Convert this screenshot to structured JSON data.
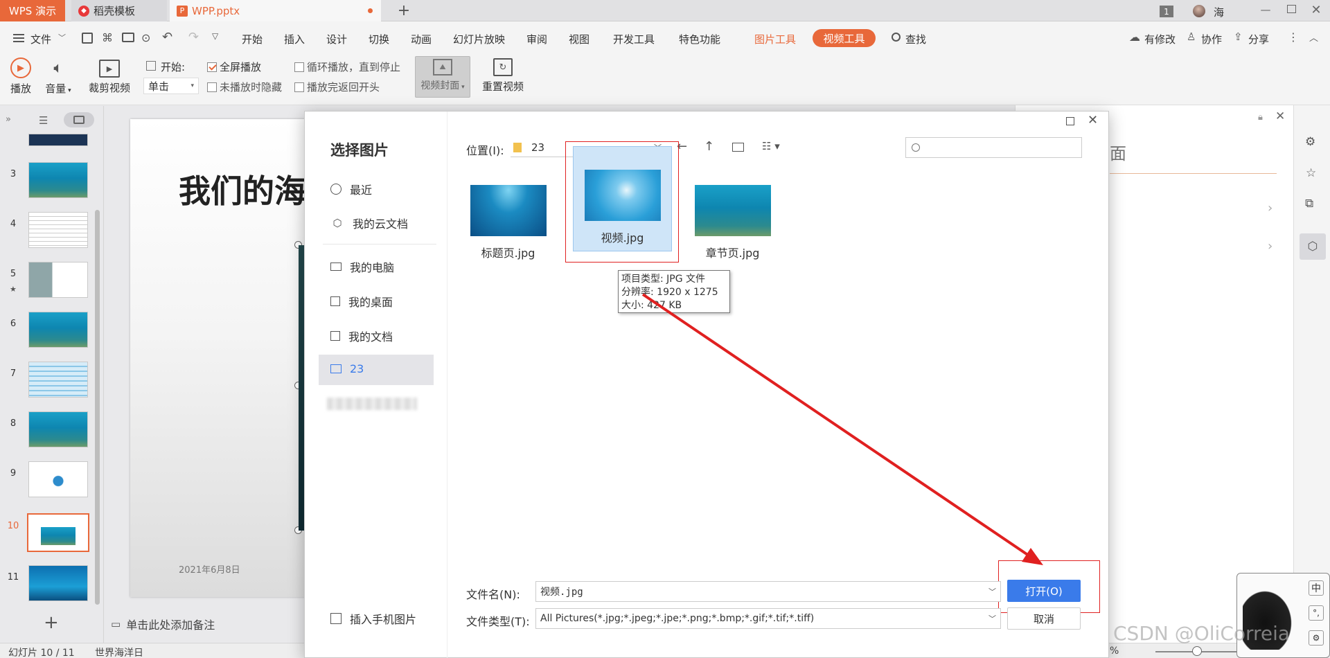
{
  "titlebar": {
    "app_tab": "WPS 演示",
    "template_tab": "稻壳模板",
    "doc_tab": "WPP.pptx",
    "page_badge": "1",
    "user_name": "海"
  },
  "menu": {
    "file": "文件",
    "items": [
      "开始",
      "插入",
      "设计",
      "切换",
      "动画",
      "幻灯片放映",
      "审阅",
      "视图",
      "开发工具",
      "特色功能"
    ],
    "picture_tools": "图片工具",
    "video_tools": "视频工具",
    "search": "查找",
    "modified": "有修改",
    "collab": "协作",
    "share": "分享"
  },
  "toolbar": {
    "play": "播放",
    "volume": "音量",
    "trim": "裁剪视频",
    "start_label": "开始:",
    "start_value": "单击",
    "fullscreen": "全屏播放",
    "hide_when_not_playing": "未播放时隐藏",
    "loop": "循环播放，直到停止",
    "rewind": "播放完返回开头",
    "cover": "视频封面",
    "reset": "重置视频"
  },
  "slides": [
    {
      "num": "3"
    },
    {
      "num": "4"
    },
    {
      "num": "5"
    },
    {
      "num": "6"
    },
    {
      "num": "7"
    },
    {
      "num": "8"
    },
    {
      "num": "9"
    },
    {
      "num": "10"
    },
    {
      "num": "11"
    }
  ],
  "slide": {
    "title": "我们的海",
    "date": "2021年6月8日"
  },
  "notes": "单击此处添加备注",
  "status": {
    "slide_count": "幻灯片 10 / 11",
    "theme": "世界海洋日",
    "zoom_suffix": "%"
  },
  "rightpane": {
    "title_fragment": "面"
  },
  "dialog": {
    "title": "选择图片",
    "location_label": "位置(I):",
    "location_value": "23",
    "sidebar": [
      "最近",
      "我的云文档",
      "我的电脑",
      "我的桌面",
      "我的文档",
      "23"
    ],
    "phone": "插入手机图片",
    "files": [
      {
        "name": "标题页.jpg"
      },
      {
        "name": "视频.jpg"
      },
      {
        "name": "章节页.jpg"
      }
    ],
    "tooltip": {
      "type": "项目类型: JPG 文件",
      "resolution": "分辨率: 1920 x 1275",
      "size": "大小: 427 KB"
    },
    "filename_label": "文件名(N):",
    "filename_value": "视频.jpg",
    "filetype_label": "文件类型(T):",
    "filetype_value": "All Pictures(*.jpg;*.jpeg;*.jpe;*.png;*.bmp;*.gif;*.tif;*.tiff)",
    "open": "打开(O)",
    "cancel": "取消"
  },
  "ime": {
    "label": "中"
  },
  "watermark": "CSDN @OliCorreia",
  "colors": {
    "accent": "#e8683a",
    "highlight": "#e02020",
    "primary": "#3a7bea"
  }
}
